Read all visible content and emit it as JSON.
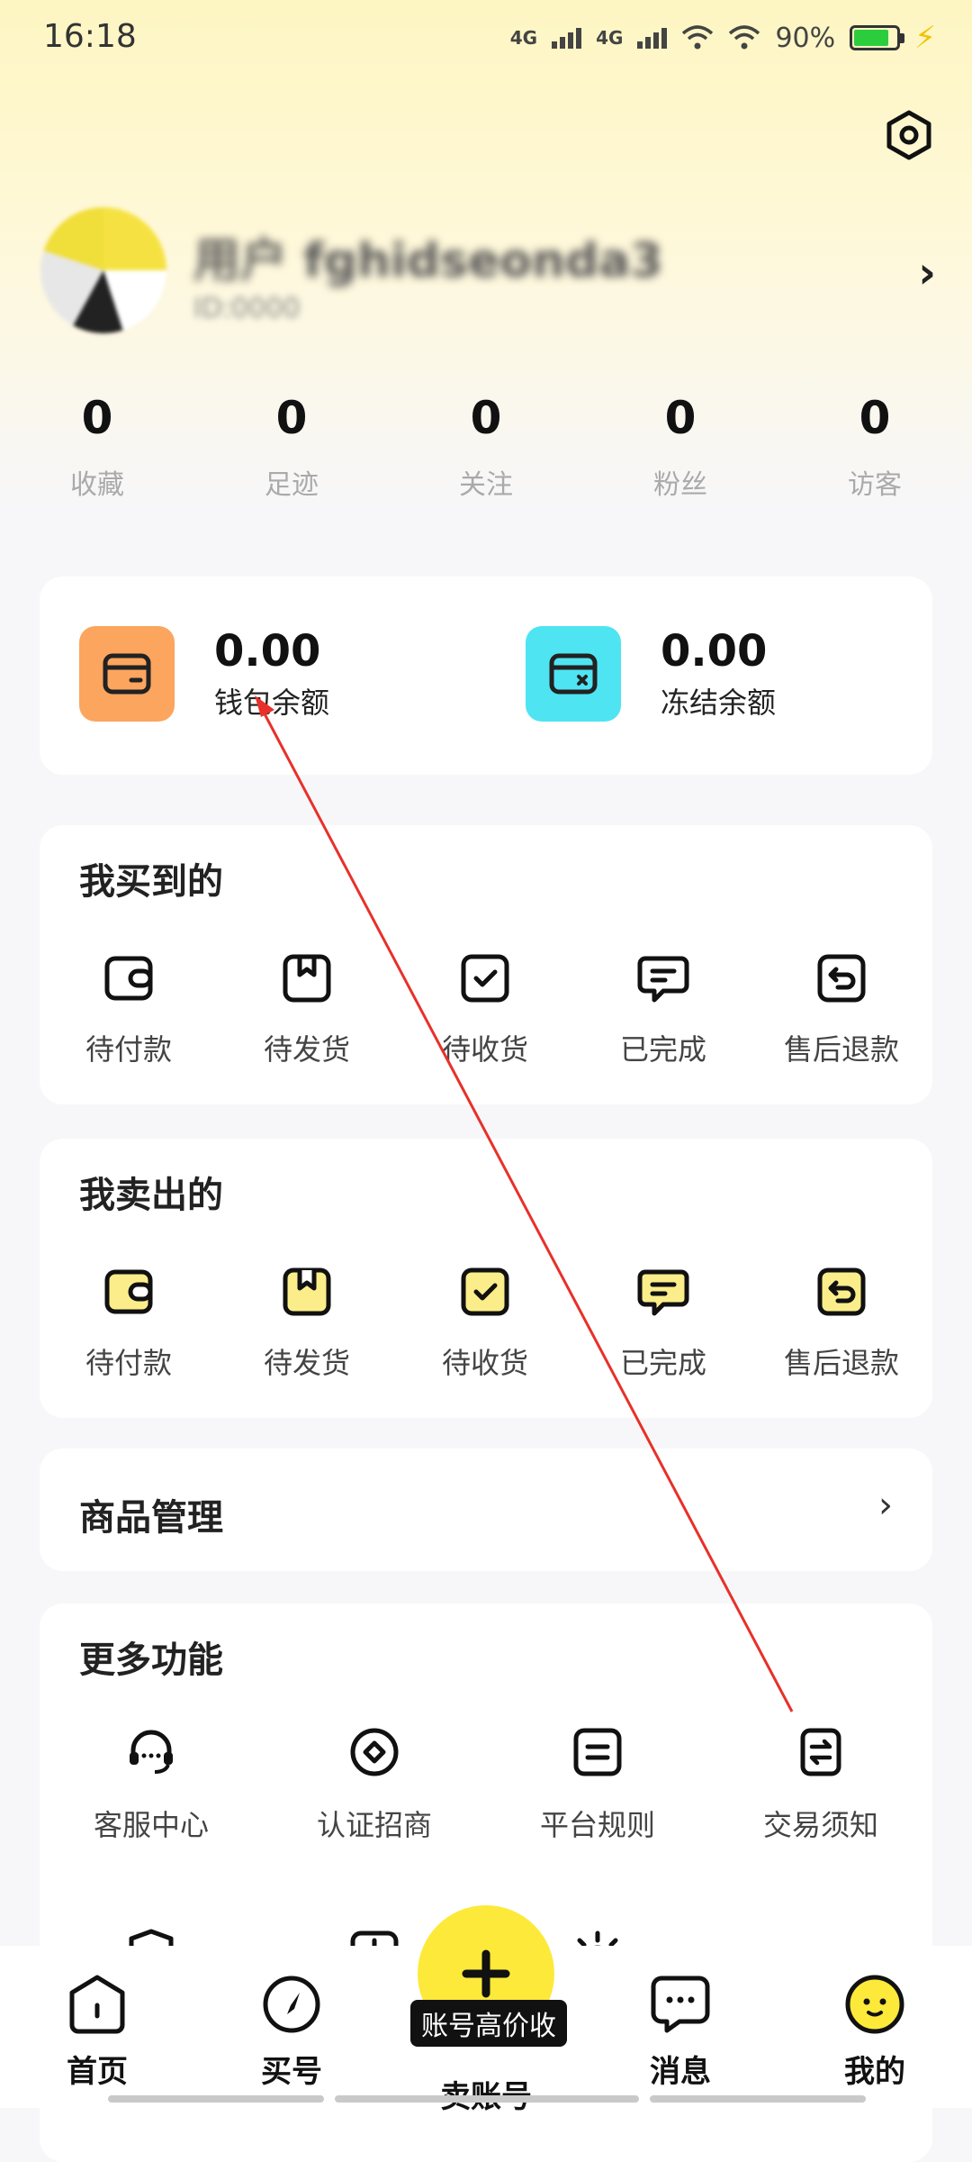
{
  "status_bar": {
    "time": "16:18",
    "network1": "4G",
    "network2": "4G",
    "battery_percent": "90%"
  },
  "profile": {
    "username": "用户 fghidseonda3",
    "sub": "ID:0000"
  },
  "stats": [
    {
      "value": "0",
      "label": "收藏"
    },
    {
      "value": "0",
      "label": "足迹"
    },
    {
      "value": "0",
      "label": "关注"
    },
    {
      "value": "0",
      "label": "粉丝"
    },
    {
      "value": "0",
      "label": "访客"
    }
  ],
  "wallet": {
    "balance": {
      "value": "0.00",
      "label": "钱包余额",
      "color": "#fca55e"
    },
    "frozen": {
      "value": "0.00",
      "label": "冻结余额",
      "color": "#4fe4f2"
    }
  },
  "bought": {
    "title": "我买到的",
    "items": [
      "待付款",
      "待发货",
      "待收货",
      "已完成",
      "售后退款"
    ]
  },
  "sold": {
    "title": "我卖出的",
    "items": [
      "待付款",
      "待发货",
      "待收货",
      "已完成",
      "售后退款"
    ]
  },
  "goods": {
    "title": "商品管理"
  },
  "more": {
    "title": "更多功能",
    "items": [
      "客服中心",
      "认证招商",
      "平台规则",
      "交易须知"
    ]
  },
  "tabbar": {
    "home": "首页",
    "buy": "买号",
    "sell": "卖账号",
    "sell_badge": "账号高价收",
    "messages": "消息",
    "mine": "我的"
  },
  "colors": {
    "accent_yellow": "#fde93a",
    "annotation_red": "#e8302a"
  }
}
